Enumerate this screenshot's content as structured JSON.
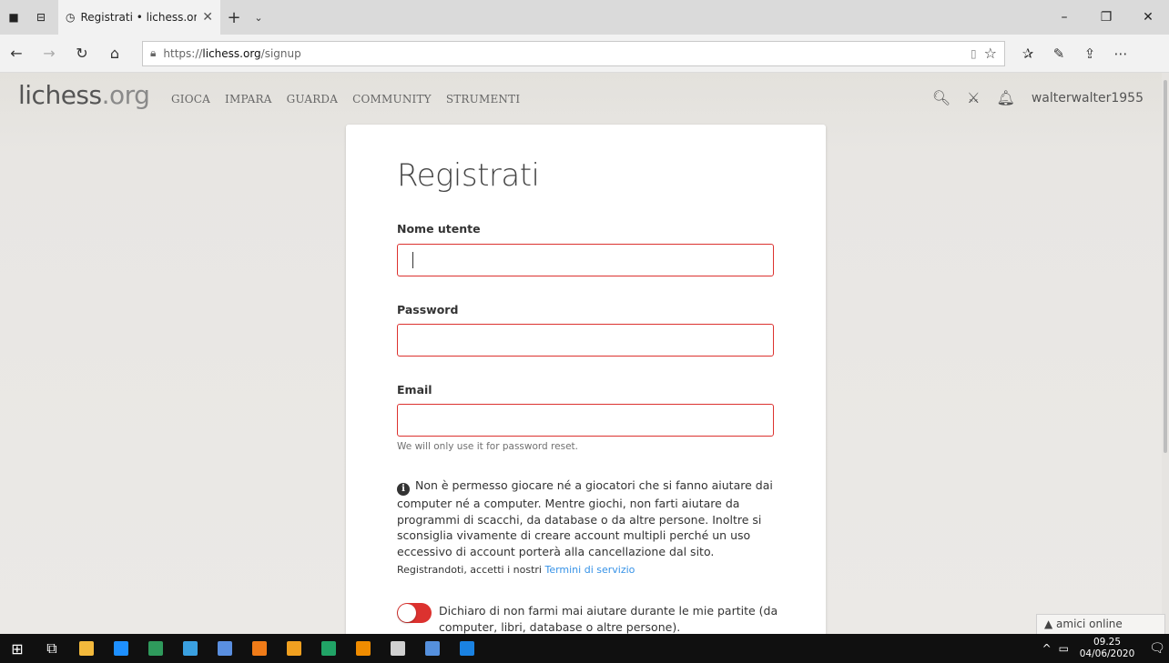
{
  "browser": {
    "tab_title": "Registrati • lichess.org",
    "url_prefix": "https://",
    "url_domain": "lichess.org",
    "url_path": "/signup"
  },
  "site": {
    "logo_main": "lichess",
    "logo_tld": ".org",
    "nav": [
      "GIOCA",
      "IMPARA",
      "GUARDA",
      "COMMUNITY",
      "STRUMENTI"
    ],
    "username": "walterwalter1955"
  },
  "form": {
    "title": "Registrati",
    "username_label": "Nome utente",
    "password_label": "Password",
    "email_label": "Email",
    "email_help": "We will only use it for password reset.",
    "notice": "Non è permesso giocare né a giocatori che si fanno aiutare dai computer né a computer. Mentre giochi, non farti aiutare da programmi di scacchi, da database o da altre persone. Inoltre si sconsiglia vivamente di creare account multipli perché un uso eccessivo di account porterà alla cancellazione dal sito.",
    "terms_prefix": "Registrandoti, accetti i nostri ",
    "terms_link": "Termini di servizio",
    "assist_toggle_label": "Dichiaro di non farmi mai aiutare durante le mie partite (da computer, libri, database o altre persone).",
    "assist_toggle_on": false
  },
  "friends_widget": "▲ amici online",
  "taskbar": {
    "time": "09.25",
    "date": "04/06/2020",
    "apps": [
      {
        "name": "file-explorer-icon",
        "color": "#f3b93c"
      },
      {
        "name": "internet-explorer-icon",
        "color": "#1e90ff"
      },
      {
        "name": "office-icon",
        "color": "#2f9a5c"
      },
      {
        "name": "control-panel-icon",
        "color": "#3aa0e0"
      },
      {
        "name": "paint-icon",
        "color": "#5a8fe0"
      },
      {
        "name": "avast-icon",
        "color": "#f07b18"
      },
      {
        "name": "media-app-icon",
        "color": "#f0a020"
      },
      {
        "name": "excel-icon",
        "color": "#21a366"
      },
      {
        "name": "vlc-icon",
        "color": "#f08c00"
      },
      {
        "name": "7zip-icon",
        "color": "#d0d0d0"
      },
      {
        "name": "word-icon",
        "color": "#5590dd"
      },
      {
        "name": "edge-icon",
        "color": "#1a82e2"
      }
    ]
  }
}
